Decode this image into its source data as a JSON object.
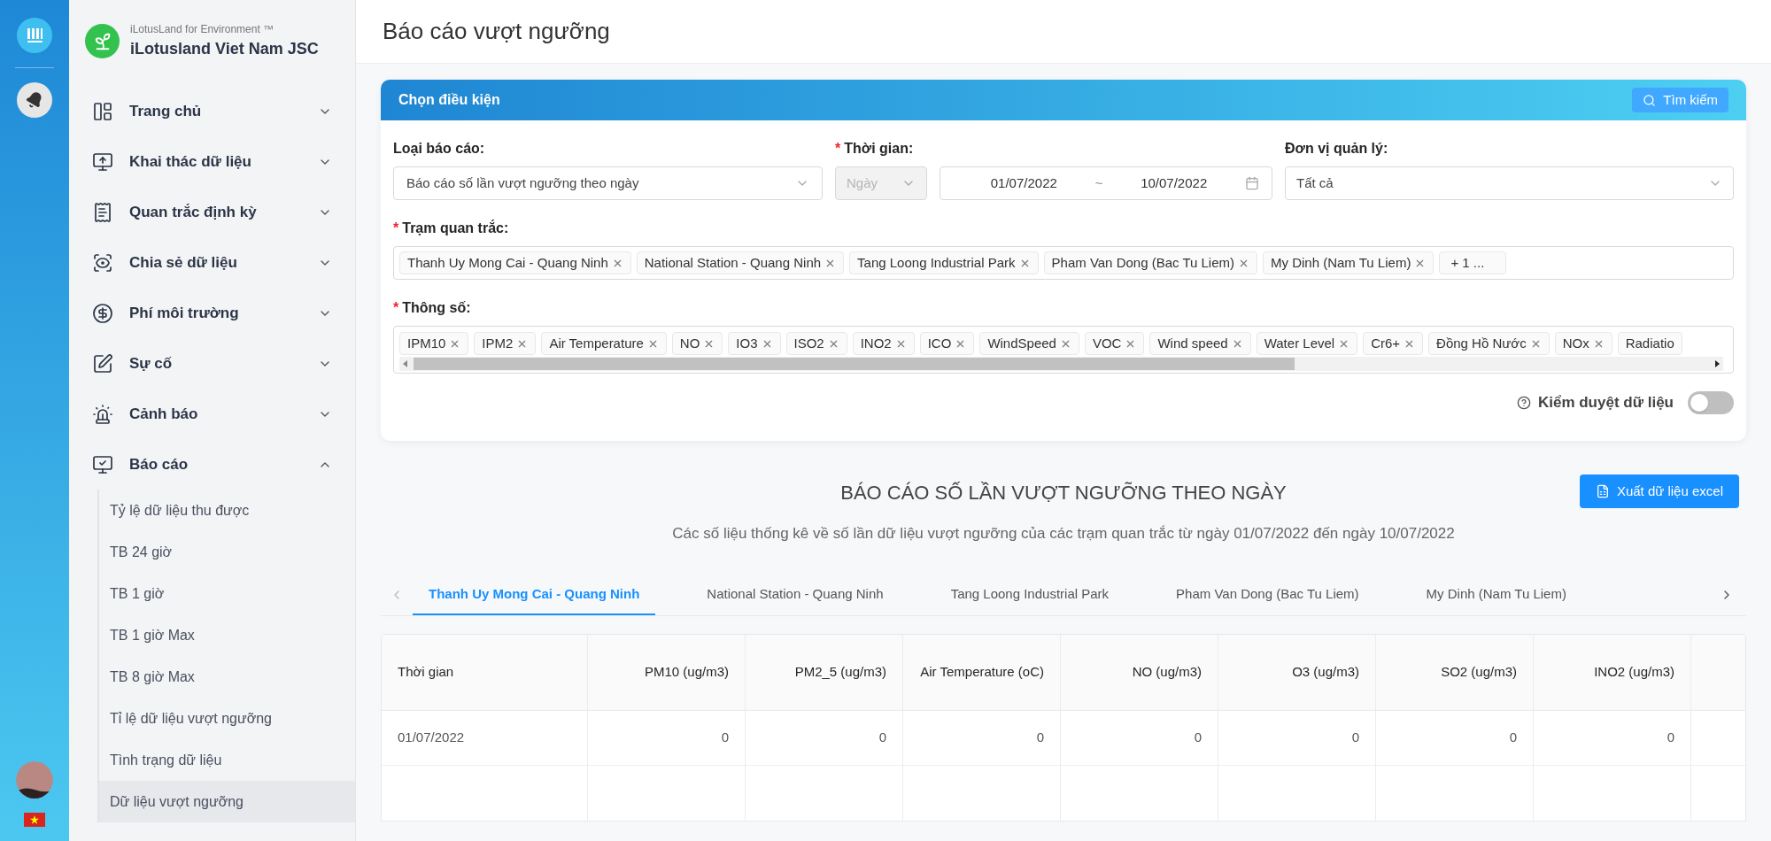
{
  "brand": {
    "tagline": "iLotusLand for Environment ™",
    "name": "iLotusland Viet Nam JSC"
  },
  "sidebar": {
    "items": [
      {
        "label": "Trang chủ",
        "expanded": false
      },
      {
        "label": "Khai thác dữ liệu",
        "expanded": false
      },
      {
        "label": "Quan trắc định kỳ",
        "expanded": false
      },
      {
        "label": "Chia sẻ dữ liệu",
        "expanded": false
      },
      {
        "label": "Phí môi trường",
        "expanded": false
      },
      {
        "label": "Sự cố",
        "expanded": false
      },
      {
        "label": "Cảnh báo",
        "expanded": false
      },
      {
        "label": "Báo cáo",
        "expanded": true,
        "children": [
          {
            "label": "Tỷ lệ dữ liệu thu được",
            "selected": false
          },
          {
            "label": "TB 24 giờ",
            "selected": false
          },
          {
            "label": "TB 1 giờ",
            "selected": false
          },
          {
            "label": "TB 1 giờ Max",
            "selected": false
          },
          {
            "label": "TB 8 giờ Max",
            "selected": false
          },
          {
            "label": "Tỉ lệ dữ liệu vượt ngưỡng",
            "selected": false
          },
          {
            "label": "Tình trạng dữ liệu",
            "selected": false
          },
          {
            "label": "Dữ liệu vượt ngưỡng",
            "selected": true
          }
        ]
      }
    ]
  },
  "page_title": "Báo cáo vượt ngưỡng",
  "filter": {
    "title": "Chọn điều kiện",
    "search_button": "Tìm kiếm",
    "report_type": {
      "label": "Loại báo cáo:",
      "value": "Báo cáo số lần vượt ngưỡng theo ngày"
    },
    "time": {
      "required_mark": "*",
      "label": "Thời gian:",
      "period": "Ngày",
      "period_disabled": true,
      "from": "01/07/2022",
      "separator": "~",
      "to": "10/07/2022"
    },
    "unit": {
      "label": "Đơn vị quản lý:",
      "value": "Tất cả"
    },
    "stations": {
      "required_mark": "*",
      "label": "Trạm quan trắc:",
      "tags": [
        "Thanh Uy Mong Cai - Quang Ninh",
        "National Station - Quang Ninh",
        "Tang Loong Industrial Park",
        "Pham Van Dong (Bac Tu Liem)",
        "My Dinh (Nam Tu Liem)"
      ],
      "more": "+ 1 ..."
    },
    "parameters": {
      "required_mark": "*",
      "label": "Thông số:",
      "tags": [
        "IPM10",
        "IPM2",
        "Air Temperature",
        "NO",
        "IO3",
        "ISO2",
        "INO2",
        "ICO",
        "WindSpeed",
        "VOC",
        "Wind speed",
        "Water Level",
        "Cr6+",
        "Đồng Hồ Nước",
        "NOx"
      ],
      "cut_tag": "Radiatio"
    },
    "moderation": {
      "label": "Kiểm duyệt dữ liệu",
      "on": false
    }
  },
  "report": {
    "title": "BÁO CÁO SỐ LẦN VƯỢT NGƯỠNG THEO NGÀY",
    "export_button": "Xuất dữ liệu excel",
    "subtitle": "Các số liệu thống kê về số lần dữ liệu vượt ngưỡng của các trạm quan trắc từ ngày 01/07/2022 đến ngày 10/07/2022",
    "tabs": [
      {
        "label": "Thanh Uy Mong Cai - Quang Ninh",
        "selected": true
      },
      {
        "label": "National Station - Quang Ninh",
        "selected": false
      },
      {
        "label": "Tang Loong Industrial Park",
        "selected": false
      },
      {
        "label": "Pham Van Dong (Bac Tu Liem)",
        "selected": false
      },
      {
        "label": "My Dinh (Nam Tu Liem)",
        "selected": false
      }
    ],
    "table": {
      "columns": [
        "Thời gian",
        "PM10 (ug/m3)",
        "PM2_5 (ug/m3)",
        "Air Temperature (oC)",
        "NO (ug/m3)",
        "O3 (ug/m3)",
        "SO2 (ug/m3)",
        "INO2 (ug/m3)"
      ],
      "rows": [
        [
          "01/07/2022",
          "0",
          "0",
          "0",
          "0",
          "0",
          "0",
          "0"
        ]
      ]
    }
  }
}
